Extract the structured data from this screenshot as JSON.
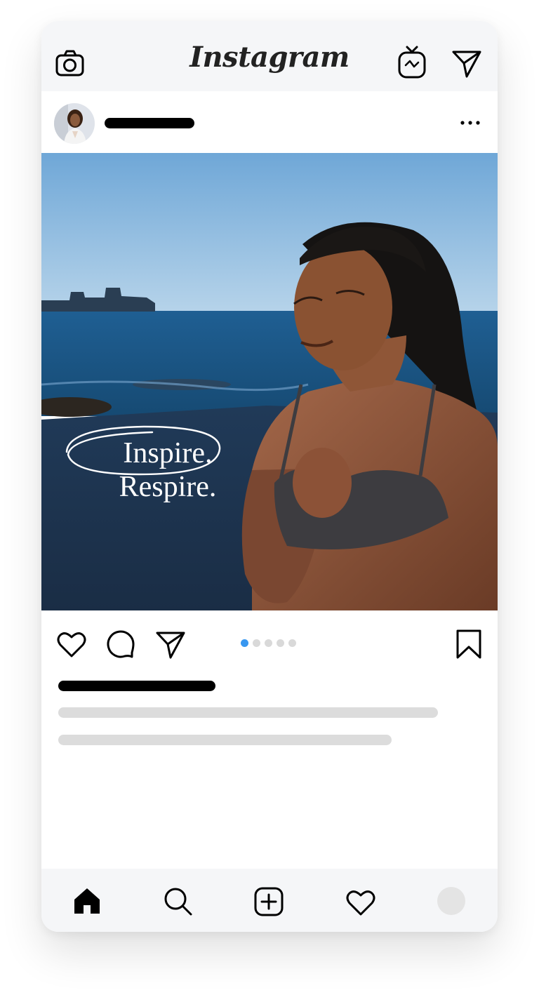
{
  "app": {
    "logo_text": "Instagram"
  },
  "topbar": {
    "left_icon": "camera-icon",
    "right_icons": [
      "igtv-icon",
      "direct-message-icon"
    ]
  },
  "post": {
    "avatar_icon": "profile-avatar-photo",
    "more_icon": "more-options-icon",
    "image_text": {
      "line1": "Inspire.",
      "line2": "Respire."
    },
    "carousel": {
      "total": 5,
      "active_index": 0,
      "active_color": "#3897f0",
      "inactive_color": "#d9d9d9"
    }
  },
  "actions": {
    "icons": [
      "like-icon",
      "comment-icon",
      "share-icon"
    ],
    "save_icon": "bookmark-icon"
  },
  "bottom_nav": {
    "items": [
      "home-icon",
      "search-icon",
      "new-post-icon",
      "activity-icon",
      "profile-icon"
    ],
    "profile_placeholder_color": "#e4e4e4"
  },
  "colors": {
    "topbar_bg": "#f5f6f8",
    "text_placeholder_dark": "#000000",
    "text_placeholder_light": "#dcdcdc"
  }
}
